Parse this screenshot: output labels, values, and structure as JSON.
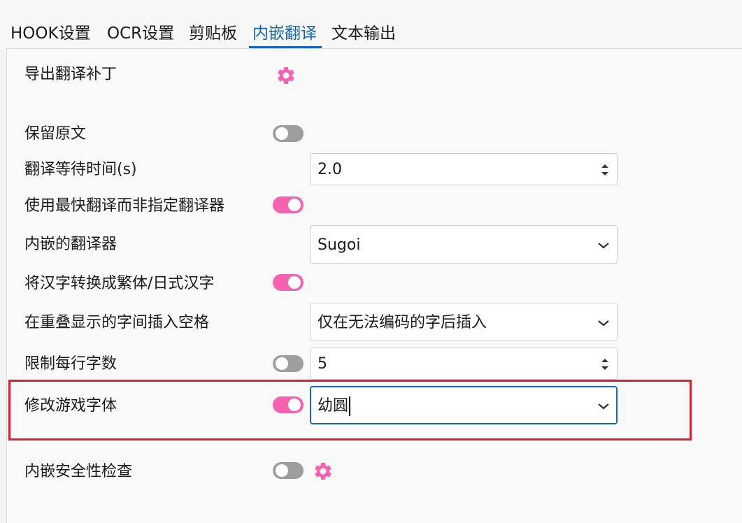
{
  "tabs": [
    {
      "label": "HOOK设置"
    },
    {
      "label": "OCR设置"
    },
    {
      "label": "剪贴板"
    },
    {
      "label": "内嵌翻译"
    },
    {
      "label": "文本输出"
    }
  ],
  "settings": {
    "export_patch": {
      "label": "导出翻译补丁",
      "icon": "gear-icon"
    },
    "keep_original": {
      "label": "保留原文",
      "enabled": false
    },
    "wait_time": {
      "label": "翻译等待时间(s)",
      "value": "2.0"
    },
    "fastest_translator": {
      "label": "使用最快翻译而非指定翻译器",
      "enabled": true
    },
    "embedded_translator": {
      "label": "内嵌的翻译器",
      "selected": "Sugoi"
    },
    "kanji_convert": {
      "label": "将汉字转换成繁体/日式汉字",
      "enabled": true
    },
    "insert_space": {
      "label": "在重叠显示的字间插入空格",
      "selected": "仅在无法编码的字后插入"
    },
    "limit_chars": {
      "label": "限制每行字数",
      "enabled": false,
      "value": "5"
    },
    "change_font": {
      "label": "修改游戏字体",
      "enabled": true,
      "value": "幼圆"
    },
    "safety_check": {
      "label": "内嵌安全性检查",
      "enabled": false,
      "icon": "gear-icon"
    }
  },
  "colors": {
    "accent": "#1565c0",
    "toggle_on": "#f462b0",
    "toggle_off": "#9e9e9e",
    "gear": "#f462b0",
    "highlight_box": "#e0202c"
  }
}
